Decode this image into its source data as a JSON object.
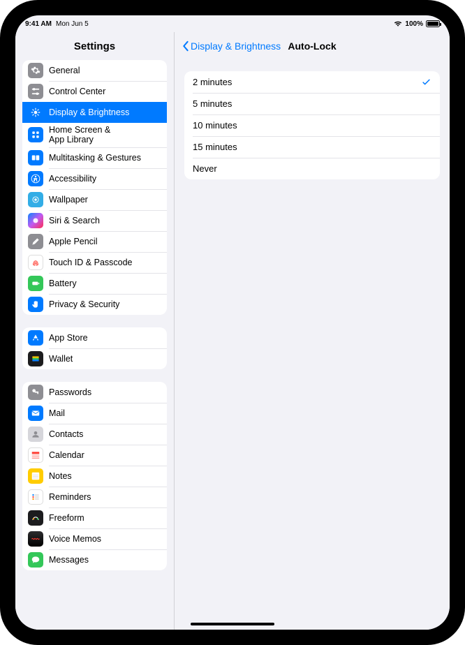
{
  "status": {
    "time": "9:41 AM",
    "date": "Mon Jun 5",
    "battery_pct": "100%"
  },
  "sidebar": {
    "title": "Settings",
    "groups": [
      {
        "items": [
          {
            "id": "general",
            "label": "General"
          },
          {
            "id": "control-center",
            "label": "Control Center"
          },
          {
            "id": "display",
            "label": "Display & Brightness",
            "active": true
          },
          {
            "id": "home-screen",
            "label": "Home Screen &\nApp Library"
          },
          {
            "id": "multitasking",
            "label": "Multitasking & Gestures"
          },
          {
            "id": "accessibility",
            "label": "Accessibility"
          },
          {
            "id": "wallpaper",
            "label": "Wallpaper"
          },
          {
            "id": "siri",
            "label": "Siri & Search"
          },
          {
            "id": "apple-pencil",
            "label": "Apple Pencil"
          },
          {
            "id": "touch-id",
            "label": "Touch ID & Passcode"
          },
          {
            "id": "battery",
            "label": "Battery"
          },
          {
            "id": "privacy",
            "label": "Privacy & Security"
          }
        ]
      },
      {
        "items": [
          {
            "id": "app-store",
            "label": "App Store"
          },
          {
            "id": "wallet",
            "label": "Wallet"
          }
        ]
      },
      {
        "items": [
          {
            "id": "passwords",
            "label": "Passwords"
          },
          {
            "id": "mail",
            "label": "Mail"
          },
          {
            "id": "contacts",
            "label": "Contacts"
          },
          {
            "id": "calendar",
            "label": "Calendar"
          },
          {
            "id": "notes",
            "label": "Notes"
          },
          {
            "id": "reminders",
            "label": "Reminders"
          },
          {
            "id": "freeform",
            "label": "Freeform"
          },
          {
            "id": "voicememos",
            "label": "Voice Memos"
          },
          {
            "id": "messages",
            "label": "Messages"
          }
        ]
      }
    ]
  },
  "main": {
    "back_label": "Display & Brightness",
    "title": "Auto-Lock",
    "options": [
      {
        "label": "2 minutes",
        "selected": true
      },
      {
        "label": "5 minutes",
        "selected": false
      },
      {
        "label": "10 minutes",
        "selected": false
      },
      {
        "label": "15 minutes",
        "selected": false
      },
      {
        "label": "Never",
        "selected": false
      }
    ]
  }
}
